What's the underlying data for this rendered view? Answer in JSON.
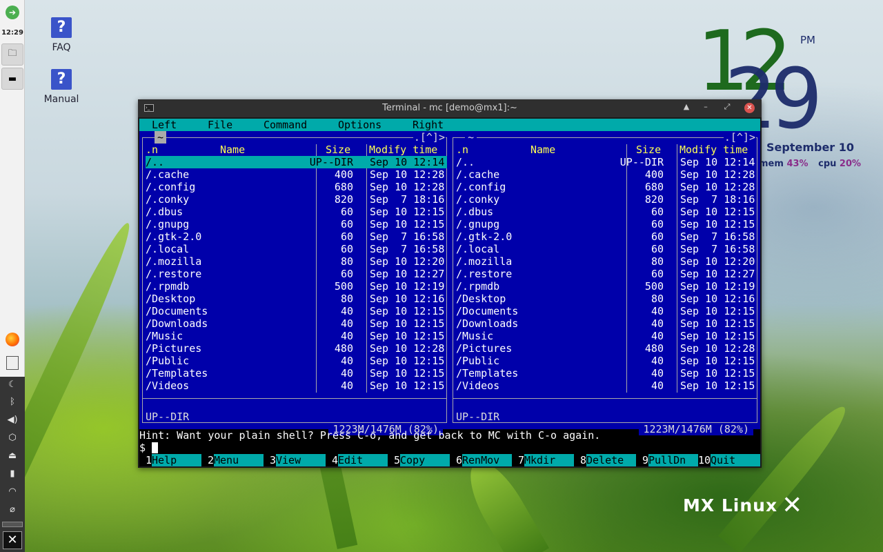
{
  "desktop": {
    "icons": [
      {
        "label": "FAQ",
        "glyph": "?"
      },
      {
        "label": "Manual",
        "glyph": "?"
      }
    ],
    "brand": "MX Linux"
  },
  "panel": {
    "clock": "12:29",
    "launcher_icons": [
      "mx-logo-icon",
      "file-manager-icon",
      "terminal-icon",
      "firefox-icon",
      "notes-icon"
    ],
    "tray_icons": [
      "night-mode-icon",
      "bluetooth-icon",
      "volume-icon",
      "package-icon",
      "eject-icon",
      "battery-icon",
      "wifi-icon",
      "clip-icon"
    ]
  },
  "conky": {
    "hour": "12",
    "minute": "29",
    "ampm": "PM",
    "date": "September 10",
    "mem_label": "mem",
    "mem_pct": "43%",
    "cpu_label": "cpu",
    "cpu_pct": "20%"
  },
  "window": {
    "title": "Terminal - mc [demo@mx1]:~",
    "buttons": [
      "▲",
      "–",
      "⤢",
      "✕"
    ]
  },
  "mc": {
    "menu": [
      "Left",
      "File",
      "Command",
      "Options",
      "Right"
    ],
    "headers": {
      "n": ".n",
      "name": "Name",
      "size": "Size",
      "time": "Modify time"
    },
    "cwd": "~",
    "corner": ".[^]>",
    "left": {
      "rows": [
        {
          "name": "/..",
          "size": "UP--DIR",
          "time": "Sep 10 12:14"
        },
        {
          "name": "/.cache",
          "size": "400",
          "time": "Sep 10 12:28"
        },
        {
          "name": "/.config",
          "size": "680",
          "time": "Sep 10 12:28"
        },
        {
          "name": "/.conky",
          "size": "820",
          "time": "Sep  7 18:16"
        },
        {
          "name": "/.dbus",
          "size": "60",
          "time": "Sep 10 12:15"
        },
        {
          "name": "/.gnupg",
          "size": "60",
          "time": "Sep 10 12:15"
        },
        {
          "name": "/.gtk-2.0",
          "size": "60",
          "time": "Sep  7 16:58"
        },
        {
          "name": "/.local",
          "size": "60",
          "time": "Sep  7 16:58"
        },
        {
          "name": "/.mozilla",
          "size": "80",
          "time": "Sep 10 12:20"
        },
        {
          "name": "/.restore",
          "size": "60",
          "time": "Sep 10 12:27"
        },
        {
          "name": "/.rpmdb",
          "size": "500",
          "time": "Sep 10 12:19"
        },
        {
          "name": "/Desktop",
          "size": "80",
          "time": "Sep 10 12:16"
        },
        {
          "name": "/Documents",
          "size": "40",
          "time": "Sep 10 12:15"
        },
        {
          "name": "/Downloads",
          "size": "40",
          "time": "Sep 10 12:15"
        },
        {
          "name": "/Music",
          "size": "40",
          "time": "Sep 10 12:15"
        },
        {
          "name": "/Pictures",
          "size": "480",
          "time": "Sep 10 12:28"
        },
        {
          "name": "/Public",
          "size": "40",
          "time": "Sep 10 12:15"
        },
        {
          "name": "/Templates",
          "size": "40",
          "time": "Sep 10 12:15"
        },
        {
          "name": "/Videos",
          "size": "40",
          "time": "Sep 10 12:15"
        }
      ],
      "mini_status": "UP--DIR",
      "usage": "1223M/1476M (82%)"
    },
    "right": {
      "rows": [
        {
          "name": "/..",
          "size": "UP--DIR",
          "time": "Sep 10 12:14"
        },
        {
          "name": "/.cache",
          "size": "400",
          "time": "Sep 10 12:28"
        },
        {
          "name": "/.config",
          "size": "680",
          "time": "Sep 10 12:28"
        },
        {
          "name": "/.conky",
          "size": "820",
          "time": "Sep  7 18:16"
        },
        {
          "name": "/.dbus",
          "size": "60",
          "time": "Sep 10 12:15"
        },
        {
          "name": "/.gnupg",
          "size": "60",
          "time": "Sep 10 12:15"
        },
        {
          "name": "/.gtk-2.0",
          "size": "60",
          "time": "Sep  7 16:58"
        },
        {
          "name": "/.local",
          "size": "60",
          "time": "Sep  7 16:58"
        },
        {
          "name": "/.mozilla",
          "size": "80",
          "time": "Sep 10 12:20"
        },
        {
          "name": "/.restore",
          "size": "60",
          "time": "Sep 10 12:27"
        },
        {
          "name": "/.rpmdb",
          "size": "500",
          "time": "Sep 10 12:19"
        },
        {
          "name": "/Desktop",
          "size": "80",
          "time": "Sep 10 12:16"
        },
        {
          "name": "/Documents",
          "size": "40",
          "time": "Sep 10 12:15"
        },
        {
          "name": "/Downloads",
          "size": "40",
          "time": "Sep 10 12:15"
        },
        {
          "name": "/Music",
          "size": "40",
          "time": "Sep 10 12:15"
        },
        {
          "name": "/Pictures",
          "size": "480",
          "time": "Sep 10 12:28"
        },
        {
          "name": "/Public",
          "size": "40",
          "time": "Sep 10 12:15"
        },
        {
          "name": "/Templates",
          "size": "40",
          "time": "Sep 10 12:15"
        },
        {
          "name": "/Videos",
          "size": "40",
          "time": "Sep 10 12:15"
        }
      ],
      "mini_status": "UP--DIR",
      "usage": "1223M/1476M (82%)"
    },
    "hint": "Hint: Want your plain shell? Press C-o, and get back to MC with C-o again.",
    "prompt": "$",
    "fkeys": [
      {
        "num": "1",
        "label": "Help"
      },
      {
        "num": "2",
        "label": "Menu"
      },
      {
        "num": "3",
        "label": "View"
      },
      {
        "num": "4",
        "label": "Edit"
      },
      {
        "num": "5",
        "label": "Copy"
      },
      {
        "num": "6",
        "label": "RenMov"
      },
      {
        "num": "7",
        "label": "Mkdir"
      },
      {
        "num": "8",
        "label": "Delete"
      },
      {
        "num": "9",
        "label": "PullDn"
      },
      {
        "num": "10",
        "label": "Quit"
      }
    ]
  }
}
